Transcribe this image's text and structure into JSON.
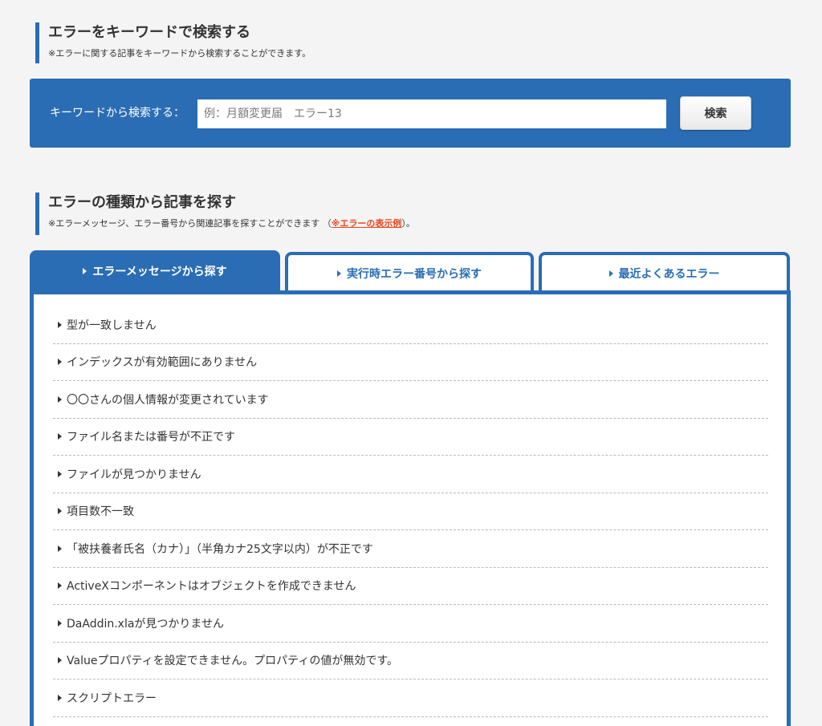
{
  "keyword_section": {
    "title": "エラーをキーワードで検索する",
    "note": "※エラーに関する記事をキーワードから検索することができます。"
  },
  "search": {
    "label": "キーワードから検索する：",
    "placeholder": "例：月額変更届　エラー13",
    "value": "",
    "button_label": "検索"
  },
  "type_section": {
    "title": "エラーの種類から記事を探す",
    "note_prefix": "※エラーメッセージ、エラー番号から関連記事を探すことができます （",
    "note_link": "※エラーの表示例",
    "note_suffix": "）。"
  },
  "tabs": [
    {
      "label": "エラーメッセージから探す",
      "active": true
    },
    {
      "label": "実行時エラー番号から探す",
      "active": false
    },
    {
      "label": "最近よくあるエラー",
      "active": false
    }
  ],
  "error_messages": [
    "型が一致しません",
    "インデックスが有効範囲にありません",
    "〇〇さんの個人情報が変更されています",
    "ファイル名または番号が不正です",
    "ファイルが見つかりません",
    "項目数不一致",
    "「被扶養者氏名（カナ）」（半角カナ25文字以内）が不正です",
    "ActiveXコンポーネントはオブジェクトを作成できません",
    "DaAddin.xlaが見つかりません",
    "Valueプロパティを設定できません。プロパティの値が無効です。",
    "スクリプトエラー"
  ],
  "colors": {
    "accent": "#2a6db4",
    "link": "#e8441b",
    "background": "#f4f4f4"
  }
}
